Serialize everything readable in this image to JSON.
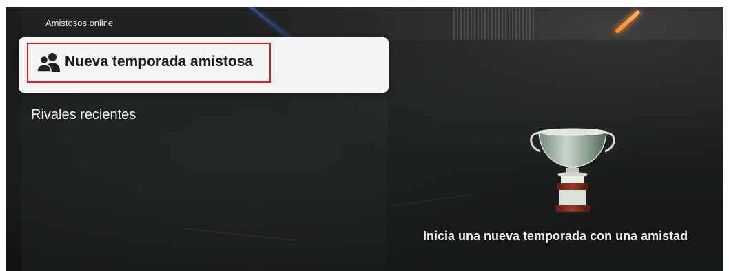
{
  "header": {
    "section_title": "Amistosos online"
  },
  "menu": {
    "selected_item": {
      "label": "Nueva temporada amistosa",
      "icon": "group-icon"
    },
    "recent_rivals_label": "Rivales recientes"
  },
  "detail": {
    "image": "trophy-cup",
    "description": "Inicia una nueva temporada con una amistad"
  },
  "colors": {
    "highlight_border": "#e31b23",
    "card_background": "#f5f5f5",
    "accent_blue": "#4a78ff",
    "accent_orange": "#ff9a30"
  }
}
